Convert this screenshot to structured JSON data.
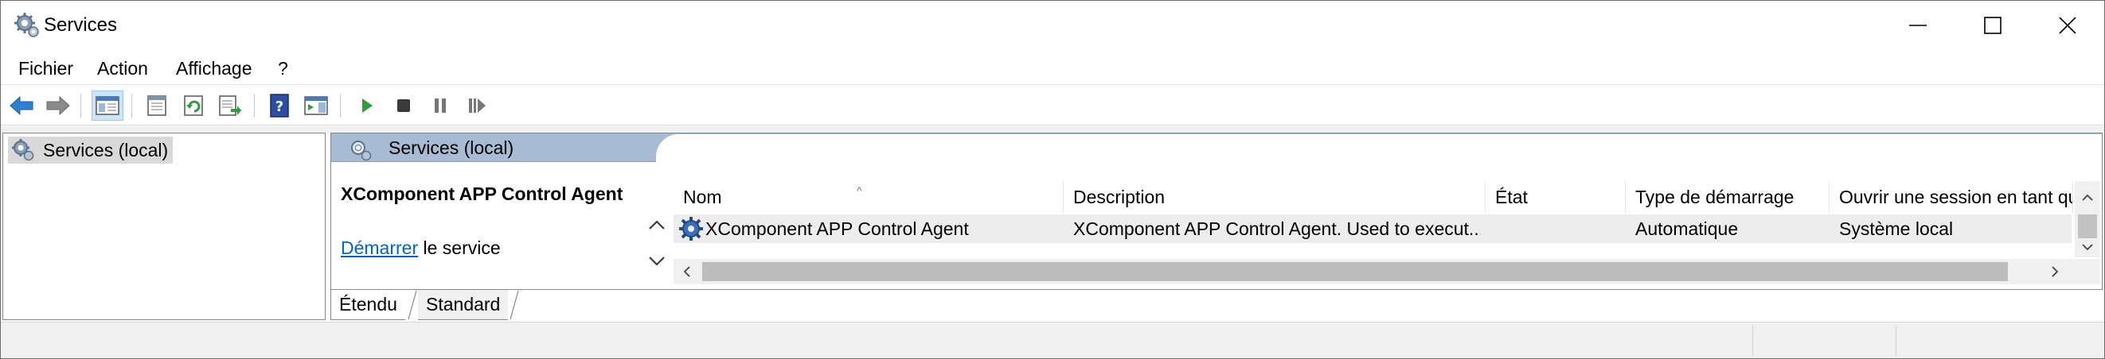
{
  "window": {
    "title": "Services",
    "controls": [
      "minimize",
      "maximize",
      "close"
    ]
  },
  "menu": {
    "items": [
      "Fichier",
      "Action",
      "Affichage",
      "?"
    ]
  },
  "toolbar": {
    "buttons": [
      "back-arrow-icon",
      "forward-arrow-icon",
      "console-tree-icon",
      "properties-icon",
      "refresh-icon",
      "export-list-icon",
      "help-icon",
      "action-pane-icon",
      "start-service-icon",
      "stop-service-icon",
      "pause-service-icon",
      "restart-service-icon"
    ]
  },
  "tree": {
    "item_label": "Services (local)"
  },
  "right_pane": {
    "header_title": "Services (local)",
    "extended": {
      "service_title": "XComponent APP Control Agent",
      "link_text": "Démarrer",
      "link_suffix": " le service"
    },
    "columns": [
      "Nom",
      "Description",
      "État",
      "Type de démarrage",
      "Ouvrir une session en tant que"
    ],
    "rows": [
      {
        "name": "XComponent APP Control Agent",
        "description": "XComponent APP Control Agent. Used to execut...",
        "state": "",
        "startup_type": "Automatique",
        "logon_as": "Système local"
      }
    ]
  },
  "tabs": [
    "Étendu",
    "Standard"
  ],
  "colors": {
    "pane_header": "#a7bbd3",
    "link": "#0066cc",
    "selected_row": "#ededed",
    "play_green": "#2e9e3c"
  }
}
